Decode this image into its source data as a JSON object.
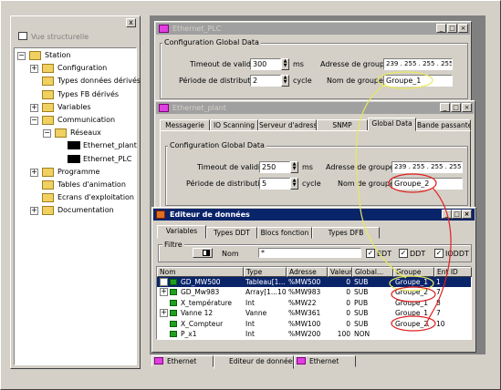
{
  "structure": {
    "title": "Vue structurelle",
    "close": "x",
    "items": [
      {
        "label": "Station",
        "exp": "−"
      },
      {
        "label": "Configuration",
        "exp": "+"
      },
      {
        "label": "Types données dérivés",
        "exp": ""
      },
      {
        "label": "Types FB dérivés",
        "exp": ""
      },
      {
        "label": "Variables",
        "exp": "+"
      },
      {
        "label": "Communication",
        "exp": "−"
      },
      {
        "label": "Réseaux",
        "exp": "−"
      },
      {
        "label": "Ethernet_plant",
        "exp": ""
      },
      {
        "label": "Ethernet_PLC",
        "exp": ""
      },
      {
        "label": "Programme",
        "exp": "+"
      },
      {
        "label": "Tables d'animation",
        "exp": ""
      },
      {
        "label": "Ecrans d'exploitation",
        "exp": ""
      },
      {
        "label": "Documentation",
        "exp": "+"
      }
    ]
  },
  "plc": {
    "title": "Ethernet_PLC",
    "section": "Configuration Global Data",
    "timeout_label": "Timeout de validité",
    "timeout_value": "300",
    "ms": "ms",
    "period_label": "Période de distribution",
    "period_value": "2",
    "cycle": "cycle",
    "group_addr_label": "Adresse de groupe",
    "group_addr": "239 . 255 . 255 . 255",
    "group_name_label": "Nom de groupe",
    "group_name": "Groupe_1"
  },
  "plant": {
    "title": "Ethernet_plant",
    "tabs": [
      "Messagerie",
      "IO Scanning",
      "Serveur d'adresses",
      "SNMP",
      "Global Data",
      "Bande passante"
    ],
    "section": "Configuration Global Data",
    "timeout_label": "Timeout de validité",
    "timeout_value": "250",
    "ms": "ms",
    "period_label": "Période de distribution",
    "period_value": "5",
    "cycle": "cycle",
    "group_addr_label": "Adresse de groupe",
    "group_addr": "239 . 255 . 255 . 255",
    "group_name_label": "Nom de groupe",
    "group_name": "Groupe_2"
  },
  "editor": {
    "title": "Editeur de données",
    "tabs": [
      "Variables",
      "Types DDT",
      "Blocs fonction",
      "Types DFB"
    ],
    "filter_label": "Filtre",
    "name_label": "Nom",
    "filter_value": "*",
    "chk_edt": "EDT",
    "chk_ddt": "DDT",
    "chk_iodt": "IODDT",
    "columns": [
      "Nom",
      "Type",
      "Adresse",
      "Valeur",
      "Global...",
      "Groupe",
      "Ent ID"
    ],
    "rows": [
      {
        "exp": "+",
        "name": "GD_MW500",
        "type": "Tableau[1...",
        "addr": "%MW500",
        "val": "0",
        "glob": "SUB",
        "group": "Groupe_1",
        "id": "1"
      },
      {
        "exp": "+",
        "name": "GD_Mw983",
        "type": "Array[1...10",
        "addr": "%MW983",
        "val": "0",
        "glob": "SUB",
        "group": "Groupe_2",
        "id": "7"
      },
      {
        "exp": "",
        "name": "X_température",
        "type": "Int",
        "addr": "%MW22",
        "val": "0",
        "glob": "PUB",
        "group": "Groupe_1",
        "id": "8"
      },
      {
        "exp": "+",
        "name": "Vanne 12",
        "type": "Vanne",
        "addr": "%MW361",
        "val": "0",
        "glob": "SUB",
        "group": "Groupe_1",
        "id": "7"
      },
      {
        "exp": "",
        "name": "X_Compteur",
        "type": "Int",
        "addr": "%MW100",
        "val": "0",
        "glob": "SUB",
        "group": "Groupe_2",
        "id": "10"
      },
      {
        "exp": "",
        "name": "P_x1",
        "type": "Int",
        "addr": "%MW200",
        "val": "100",
        "glob": "NON",
        "group": "",
        "id": ""
      }
    ]
  },
  "taskbar": [
    "Ethernet",
    "Editeur de données",
    "Ethernet"
  ],
  "colors": {
    "accent": "#0a246a",
    "annotation_red": "#e02020",
    "annotation_yellow": "#e8e860"
  }
}
